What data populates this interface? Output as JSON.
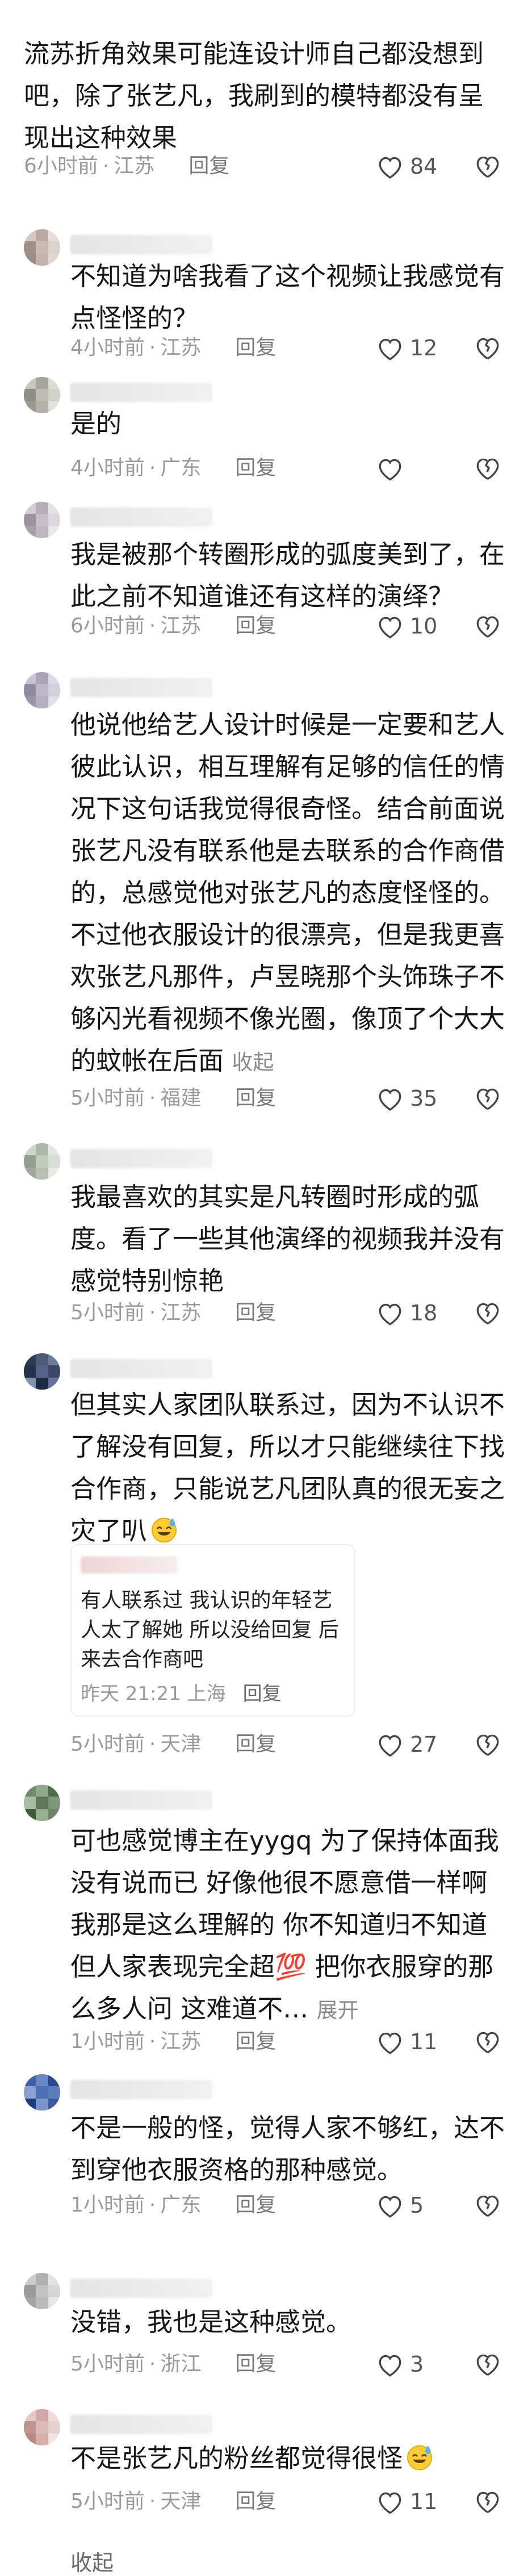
{
  "comments": [
    {
      "text": "流苏折角效果可能连设计师自己都没想到吧，除了张艺凡，我刷到的模特都没有呈现出这种效果",
      "time": "6小时前",
      "location": "江苏",
      "reply_label": "回复",
      "likes": "84",
      "avatar_colors": []
    },
    {
      "text": "不知道为啥我看了这个视频让我感觉有点怪怪的？",
      "time": "4小时前",
      "location": "江苏",
      "reply_label": "回复",
      "likes": "12",
      "avatar_colors": [
        "#d8c9c2",
        "#b9a9a0",
        "#e6ddd8",
        "#a08f86",
        "#cbbab2",
        "#ded2cc",
        "#9e8b82",
        "#c4b3aa",
        "#e0d6d0"
      ]
    },
    {
      "text": "是的",
      "time": "4小时前",
      "location": "广东",
      "reply_label": "回复",
      "likes": "",
      "avatar_colors": [
        "#c8c8c0",
        "#a6a69c",
        "#dcdcd4",
        "#8e8e86",
        "#bcbcb2",
        "#d2d2ca",
        "#9a9a90",
        "#b2b2a8",
        "#e2e2dc"
      ]
    },
    {
      "text": "我是被那个转圈形成的弧度美到了，在此之前不知道谁还有这样的演绎？",
      "time": "6小时前",
      "location": "江苏",
      "reply_label": "回复",
      "likes": "10",
      "avatar_colors": [
        "#d4ccd6",
        "#b6adb8",
        "#e6e0e8",
        "#9c93a0",
        "#c6bec8",
        "#dcd6de",
        "#a69ea8",
        "#bfb7c1",
        "#ebe6ec"
      ]
    },
    {
      "text": "他说他给艺人设计时候是一定要和艺人彼此认识，相互理解有足够的信任的情况下这句话我觉得很奇怪。结合前面说张艺凡没有联系他是去联系的合作商借的，总感觉他对张艺凡的态度怪怪的。不过他衣服设计的很漂亮，但是我更喜欢张艺凡那件，卢昱晓那个头饰珠子不够闪光看视频不像光圈，像顶了个大大的蚊帐在后面",
      "more_label": "收起",
      "time": "5小时前",
      "location": "福建",
      "reply_label": "回复",
      "likes": "35",
      "avatar_colors": [
        "#c9c4d2",
        "#aaa4b6",
        "#ddd9e4",
        "#918aa0",
        "#bdb7c8",
        "#d4cfdc",
        "#9d96ab",
        "#b5afc2",
        "#e4e0ea"
      ]
    },
    {
      "text": "我最喜欢的其实是凡转圈时形成的弧度。看了一些其他演绎的视频我并没有感觉特别惊艳",
      "time": "5小时前",
      "location": "江苏",
      "reply_label": "回复",
      "likes": "18",
      "avatar_colors": [
        "#cfd6cc",
        "#aeb8aa",
        "#e2e8e0",
        "#949f90",
        "#c1cabe",
        "#d7ded4",
        "#a0aa9c",
        "#b8c1b4",
        "#e6ebe4"
      ]
    },
    {
      "text": "但其实人家团队联系过，因为不认识不了解没有回复，所以才只能继续往下找合作商，只能说艺凡团队真的很无妄之灾了叭",
      "time": "5小时前",
      "location": "天津",
      "reply_label": "回复",
      "likes": "27",
      "avatar_colors": [
        "#2e3a58",
        "#4d5a7a",
        "#6f7b98",
        "#24304c",
        "#57638a",
        "#3b4766",
        "#8592ad",
        "#1d2842",
        "#66729a"
      ],
      "quote": {
        "text": "有人联系过 我认识的年轻艺人太了解她 所以没给回复 后来去合作商吧",
        "time": "昨天 21:21",
        "location": "上海",
        "reply_label": "回复"
      }
    },
    {
      "text": "可也感觉博主在yygq 为了保持体面我没有说而已 好像他很不愿意借一样啊 我那是这么理解的 你不知道归不知道 但人家表现完全超💯 把你衣服穿的那么多人问 这难道不…",
      "more_label": "展开",
      "time": "1小时前",
      "location": "江苏",
      "reply_label": "回复",
      "likes": "11",
      "avatar_colors": [
        "#6f8a6a",
        "#8fa888",
        "#4f6a4c",
        "#a7bca0",
        "#5d7858",
        "#7c9876",
        "#3f5a3c",
        "#98b090",
        "#6a8465"
      ]
    },
    {
      "text": "不是一般的怪，觉得人家不够红，达不到穿他衣服资格的那种感觉。",
      "time": "1小时前",
      "location": "广东",
      "reply_label": "回复",
      "likes": "5",
      "avatar_colors": [
        "#3d5fa8",
        "#6a86c2",
        "#2a4a8c",
        "#8aa0d0",
        "#4e6fb4",
        "#5c7cbc",
        "#1f3d7c",
        "#7a94ca",
        "#3a5aa2"
      ]
    },
    {
      "text": "没错，我也是这种感觉。",
      "time": "5小时前",
      "location": "浙江",
      "reply_label": "回复",
      "likes": "3",
      "avatar_colors": [
        "#cdcdcd",
        "#b0b0b0",
        "#e2e2e2",
        "#9a9a9a",
        "#c2c2c2",
        "#d6d6d6",
        "#a4a4a4",
        "#bbbbbb",
        "#e6e6e6"
      ]
    },
    {
      "text": "不是张艺凡的粉丝都觉得很怪",
      "time": "5小时前",
      "location": "天津",
      "reply_label": "回复",
      "likes": "11",
      "avatar_colors": [
        "#e6c8c6",
        "#d2a8a4",
        "#f0dcda",
        "#c09490",
        "#dcbab6",
        "#e8d0ce",
        "#b88884",
        "#d6b0ac",
        "#f2e2e0"
      ]
    }
  ],
  "collapse_label": "收起",
  "icons": {
    "like": "heart-outline-icon",
    "dislike": "broken-heart-outline-icon",
    "emoji_sweat": "sweat-smile-emoji",
    "emoji_hundred": "hundred-points-emoji"
  }
}
